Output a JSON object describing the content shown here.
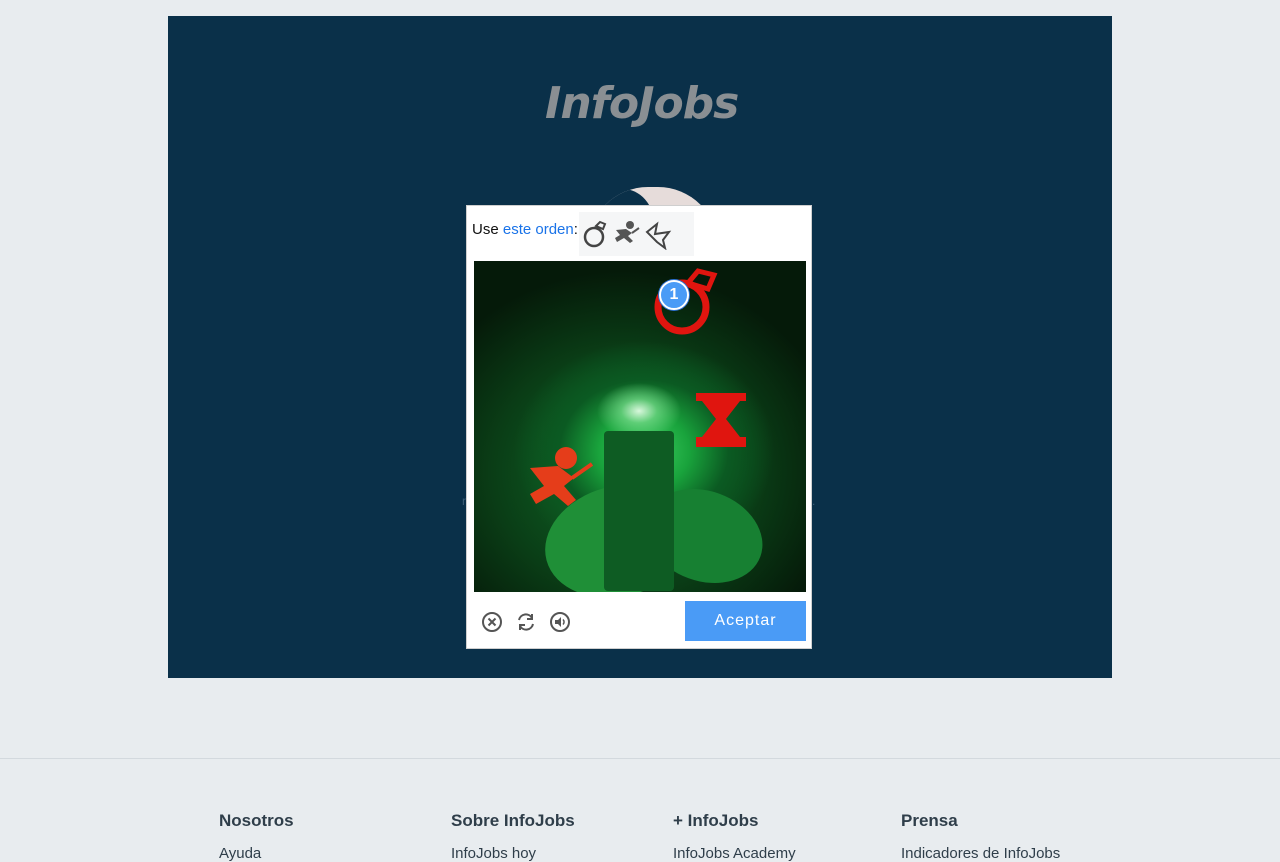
{
  "brand": {
    "logo_text": "InfoJobs"
  },
  "captcha": {
    "prompt_prefix": "Use",
    "prompt_link": "este orden",
    "prompt_suffix": ":",
    "order_icons": [
      "ring-icon",
      "person-crouching-icon",
      "origami-icon"
    ],
    "targets": [
      "ring-target-icon",
      "hourglass-target-icon",
      "person-target-icon"
    ],
    "selected_pin_number": "1",
    "controls": [
      "close-icon",
      "refresh-icon",
      "audio-icon"
    ],
    "accept_label": "Aceptar",
    "colors": {
      "accent": "#4a9bf6",
      "target": "#e0150f",
      "link": "#1a73e8"
    }
  },
  "footer": {
    "columns": [
      {
        "title": "Nosotros",
        "first_link": "Ayuda"
      },
      {
        "title": "Sobre InfoJobs",
        "first_link": "InfoJobs hoy"
      },
      {
        "title": "+ InfoJobs",
        "first_link": "InfoJobs Academy"
      },
      {
        "title": "Prensa",
        "first_link": "Indicadores de InfoJobs"
      }
    ]
  }
}
